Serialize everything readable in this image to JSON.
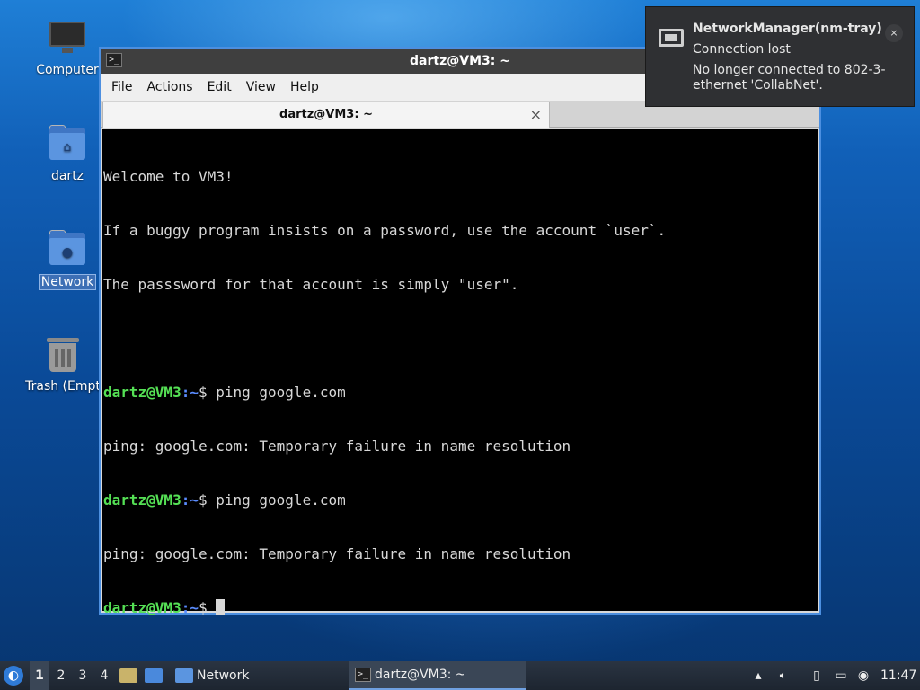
{
  "desktop": {
    "icons": [
      {
        "label": "Computer"
      },
      {
        "label": "dartz"
      },
      {
        "label": "Network"
      },
      {
        "label": "Trash (Empt"
      }
    ]
  },
  "window": {
    "title": "dartz@VM3: ~",
    "menu": [
      "File",
      "Actions",
      "Edit",
      "View",
      "Help"
    ],
    "tab": {
      "title": "dartz@VM3: ~",
      "close": "×"
    }
  },
  "terminal": {
    "lines": [
      "Welcome to VM3!",
      "If a buggy program insists on a password, use the account `user`.",
      "The passsword for that account is simply \"user\"."
    ],
    "prompt_user": "dartz@VM3",
    "prompt_path": ":~",
    "prompt_symbol": "$ ",
    "history": [
      {
        "command": "ping google.com",
        "output": "ping: google.com: Temporary failure in name resolution"
      },
      {
        "command": "ping google.com",
        "output": "ping: google.com: Temporary failure in name resolution"
      }
    ]
  },
  "notification": {
    "title": "NetworkManager(nm-tray)",
    "subtitle": "Connection lost",
    "body": "No longer connected to 802-3-ethernet 'CollabNet'.",
    "close": "×"
  },
  "taskbar": {
    "workspaces": [
      "1",
      "2",
      "3",
      "4"
    ],
    "active_workspace": "1",
    "tasks": [
      {
        "label": "Network"
      },
      {
        "label": "dartz@VM3: ~"
      }
    ],
    "clock": "11:47"
  }
}
